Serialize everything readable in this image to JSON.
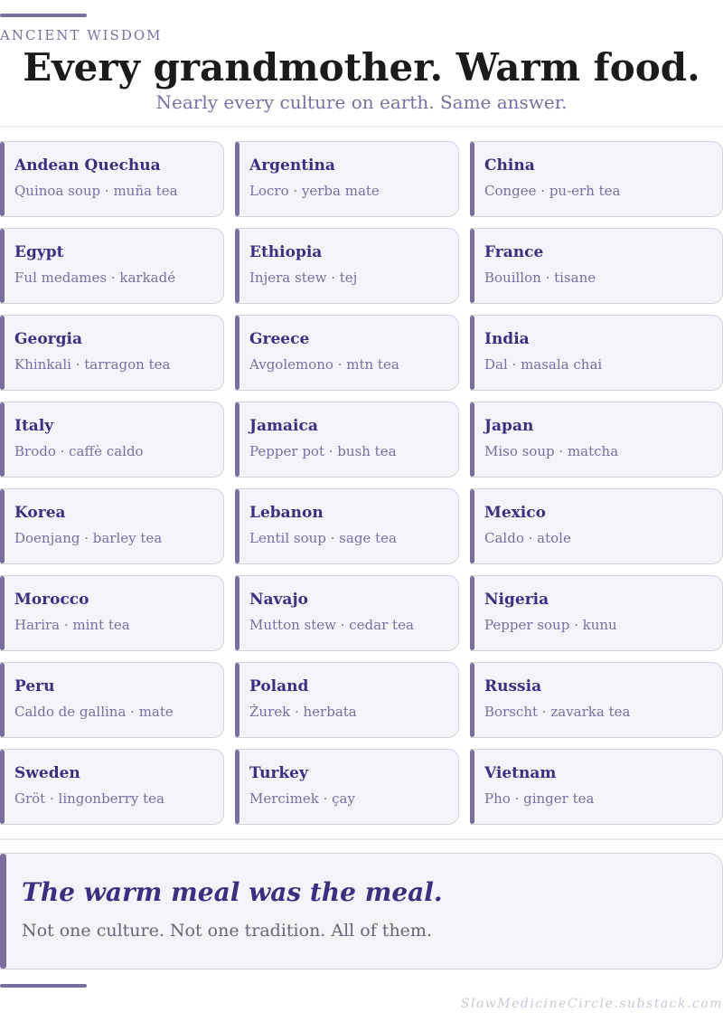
{
  "header": {
    "eyebrow": "ANCIENT WISDOM",
    "title": "Every grandmother. Warm food.",
    "subtitle": "Nearly every culture on earth. Same answer."
  },
  "cultures": [
    {
      "name": "Andean Quechua",
      "foods": "Quinoa soup · muña tea"
    },
    {
      "name": "Argentina",
      "foods": "Locro · yerba mate"
    },
    {
      "name": "China",
      "foods": "Congee · pu-erh tea"
    },
    {
      "name": "Egypt",
      "foods": "Ful medames · karkadé"
    },
    {
      "name": "Ethiopia",
      "foods": "Injera stew · tej"
    },
    {
      "name": "France",
      "foods": "Bouillon · tisane"
    },
    {
      "name": "Georgia",
      "foods": "Khinkali · tarragon tea"
    },
    {
      "name": "Greece",
      "foods": "Avgolemono · mtn tea"
    },
    {
      "name": "India",
      "foods": "Dal · masala chai"
    },
    {
      "name": "Italy",
      "foods": "Brodo · caffè caldo"
    },
    {
      "name": "Jamaica",
      "foods": "Pepper pot · bush tea"
    },
    {
      "name": "Japan",
      "foods": "Miso soup · matcha"
    },
    {
      "name": "Korea",
      "foods": "Doenjang · barley tea"
    },
    {
      "name": "Lebanon",
      "foods": "Lentil soup · sage tea"
    },
    {
      "name": "Mexico",
      "foods": "Caldo · atole"
    },
    {
      "name": "Morocco",
      "foods": "Harira · mint tea"
    },
    {
      "name": "Navajo",
      "foods": "Mutton stew · cedar tea"
    },
    {
      "name": "Nigeria",
      "foods": "Pepper soup · kunu"
    },
    {
      "name": "Peru",
      "foods": "Caldo de gallina · mate"
    },
    {
      "name": "Poland",
      "foods": "Żurek · herbata"
    },
    {
      "name": "Russia",
      "foods": "Borscht · zavarka tea"
    },
    {
      "name": "Sweden",
      "foods": "Gröt · lingonberry tea"
    },
    {
      "name": "Turkey",
      "foods": "Mercimek · çay"
    },
    {
      "name": "Vietnam",
      "foods": "Pho · ginger tea"
    }
  ],
  "closing": {
    "headline": "The warm meal was the meal.",
    "body": "Not one culture. Not one tradition. All of them."
  },
  "footer": {
    "credit": "SlowMedicineCircle.substack.com"
  },
  "colors": {
    "accent": "#7b6fa0",
    "heading": "#3c2f80",
    "card_bg": "#f4f3f9",
    "card_border": "#d3d1de"
  }
}
